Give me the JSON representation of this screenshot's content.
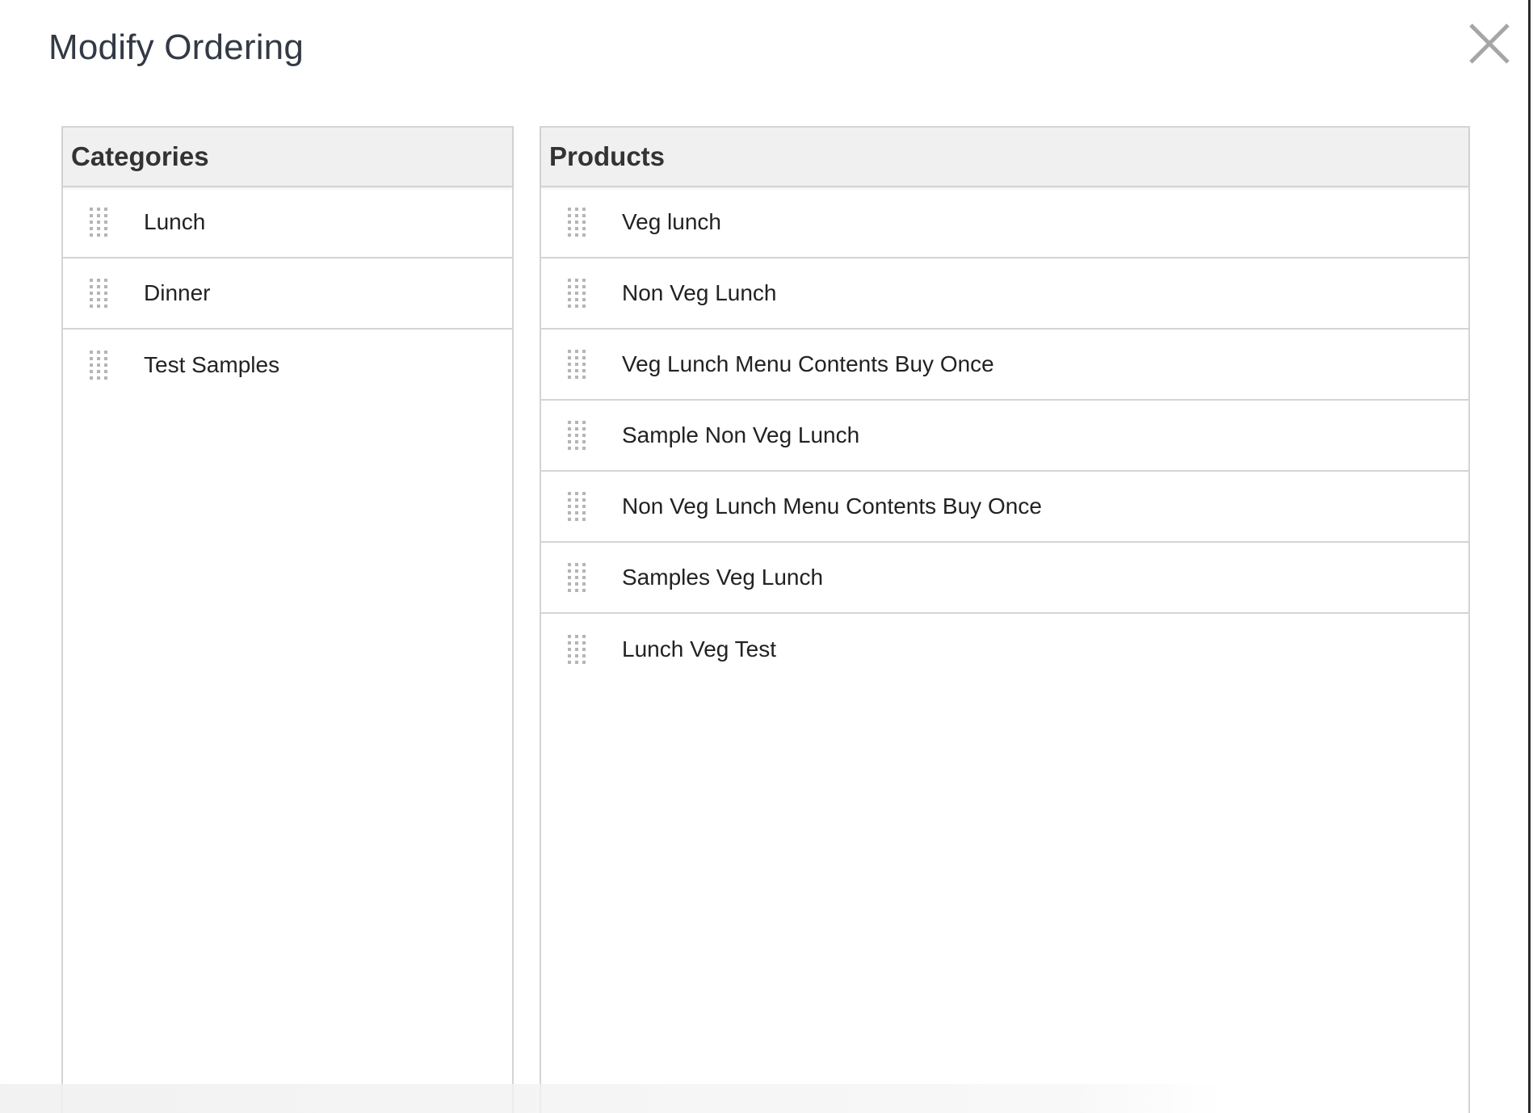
{
  "modal": {
    "title": "Modify Ordering",
    "close_icon": "close-icon"
  },
  "categories": {
    "header": "Categories",
    "items": [
      {
        "label": "Lunch"
      },
      {
        "label": "Dinner"
      },
      {
        "label": "Test Samples"
      }
    ]
  },
  "products": {
    "header": "Products",
    "items": [
      {
        "label": "Veg lunch"
      },
      {
        "label": "Non Veg Lunch"
      },
      {
        "label": "Veg Lunch Menu Contents Buy Once"
      },
      {
        "label": "Sample Non Veg Lunch"
      },
      {
        "label": "Non Veg Lunch Menu Contents Buy Once"
      },
      {
        "label": "Samples Veg Lunch"
      },
      {
        "label": "Lunch Veg Test"
      }
    ]
  },
  "icons": {
    "drag_handle": "drag-handle-icon"
  },
  "colors": {
    "header_bg": "#f0f0f0",
    "border": "#d4d4d4",
    "title_text": "#333a45",
    "handle": "#b5b5b5"
  }
}
